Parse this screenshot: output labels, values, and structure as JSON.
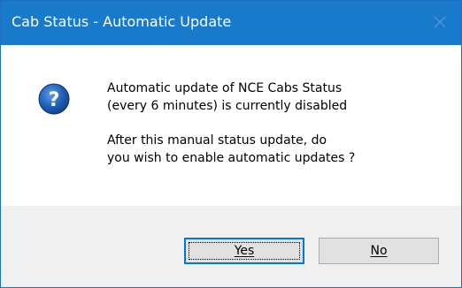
{
  "window": {
    "title": "Cab Status - Automatic Update",
    "close_icon": "close-icon"
  },
  "dialog": {
    "icon": "question-icon",
    "message_lines": [
      "Automatic update of NCE Cabs Status",
      "(every 6 minutes) is currently disabled"
    ],
    "question_lines": [
      "After this manual status update, do",
      "you wish to enable automatic updates ?"
    ]
  },
  "buttons": {
    "yes_label": "Yes",
    "no_label": "No"
  },
  "colors": {
    "titlebar": "#1979ca",
    "footer": "#f0f0f0",
    "icon_blue": "#1e5fb4",
    "focus_border": "#0078d7"
  }
}
